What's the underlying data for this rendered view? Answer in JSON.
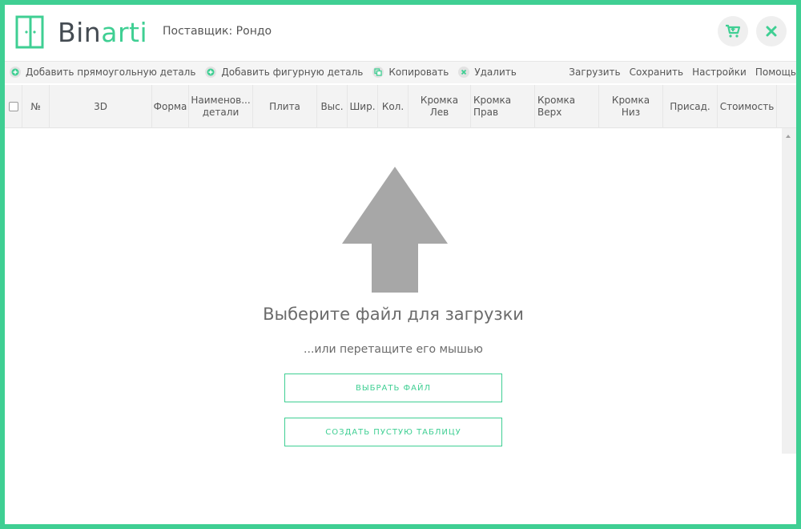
{
  "app": {
    "logo_main": "Bin",
    "logo_accent": "arti",
    "supplier": "Поставщик: Рондо"
  },
  "toolbar": {
    "left": [
      {
        "label": "Добавить прямоугольную деталь",
        "icon": "plus-icon"
      },
      {
        "label": "Добавить фигурную деталь",
        "icon": "plus-icon"
      },
      {
        "label": "Копировать",
        "icon": "copy-icon"
      },
      {
        "label": "Удалить",
        "icon": "delete-icon"
      }
    ],
    "right": [
      "Загрузить",
      "Сохранить",
      "Настройки",
      "Помощь"
    ]
  },
  "table": {
    "columns": [
      {
        "label": "№"
      },
      {
        "label": "3D"
      },
      {
        "label": "Форма"
      },
      {
        "label": "Наименов... детали"
      },
      {
        "label": "Плита"
      },
      {
        "label": "Выс."
      },
      {
        "label": "Шир."
      },
      {
        "label": "Кол."
      },
      {
        "label": "Кромка Лев"
      },
      {
        "label": "Кромка Прав"
      },
      {
        "label": "Кромка Верх"
      },
      {
        "label": "Кромка Низ"
      },
      {
        "label": "Присад."
      },
      {
        "label": "Стоимость"
      }
    ]
  },
  "upload": {
    "title": "Выберите файл для загрузки",
    "subtitle": "...или перетащите его мышью",
    "select_button": "ВЫБРАТЬ ФАЙЛ",
    "empty_button": "СОЗДАТЬ ПУСТУЮ ТАБЛИЦУ"
  },
  "colors": {
    "accent": "#3fcf93",
    "arrow": "#a7a7a7"
  }
}
